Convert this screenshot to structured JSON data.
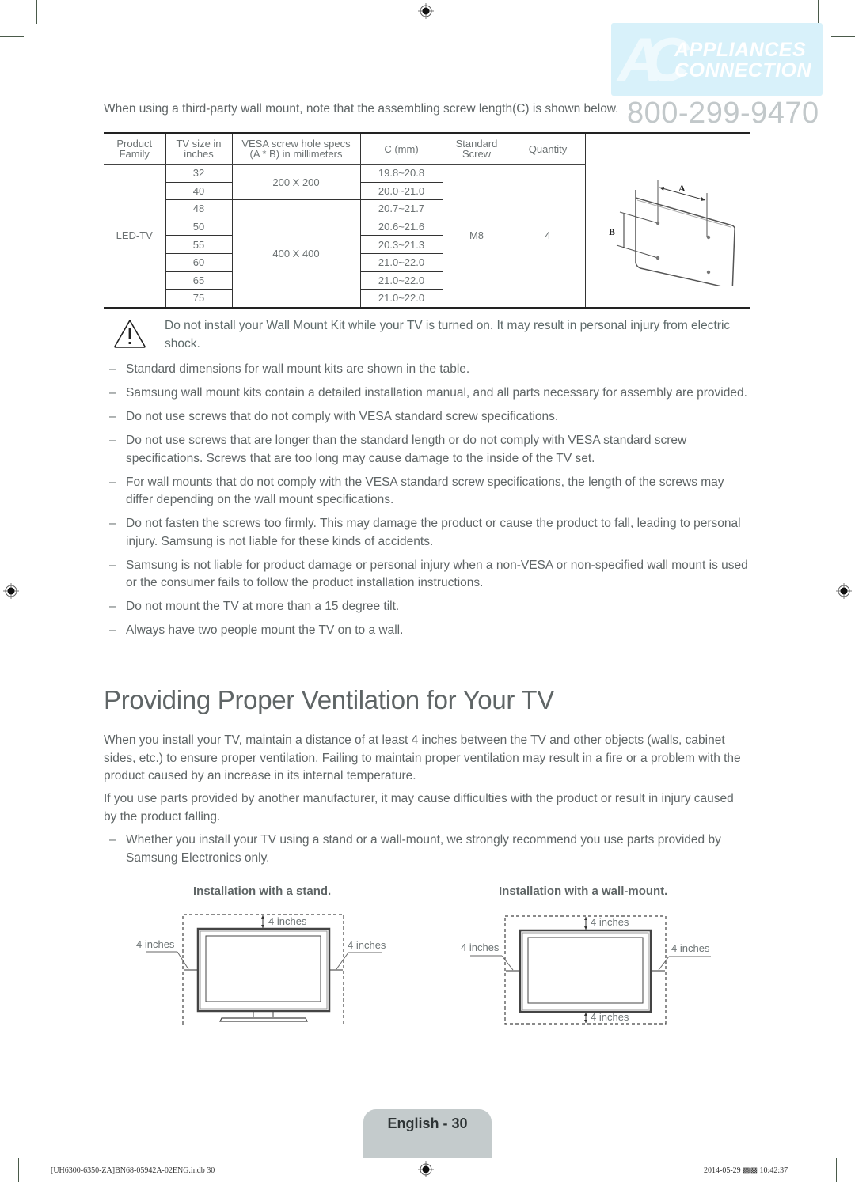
{
  "watermark": {
    "logo_initials": "AC",
    "logo_line1": "APPLIANCES",
    "logo_line2": "CONNECTION",
    "phone": "800-299-9470"
  },
  "intro": "When using a third-party wall mount, note that the assembling screw length(C) is shown below.",
  "table": {
    "headers": {
      "product_family": [
        "Product",
        "Family"
      ],
      "tv_size": [
        "TV size in",
        "inches"
      ],
      "vesa": [
        "VESA screw hole specs",
        "(A * B) in millimeters"
      ],
      "c_mm": "C (mm)",
      "standard_screw": [
        "Standard",
        "Screw"
      ],
      "quantity": "Quantity"
    },
    "product_family": "LED-TV",
    "standard_screw": "M8",
    "quantity": "4",
    "vesa_groups": [
      "200 X 200",
      "400 X 400"
    ],
    "rows": [
      {
        "size": "32",
        "c": "19.8~20.8"
      },
      {
        "size": "40",
        "c": "20.0~21.0"
      },
      {
        "size": "48",
        "c": "20.7~21.7"
      },
      {
        "size": "50",
        "c": "20.6~21.6"
      },
      {
        "size": "55",
        "c": "20.3~21.3"
      },
      {
        "size": "60",
        "c": "21.0~22.0"
      },
      {
        "size": "65",
        "c": "21.0~22.0"
      },
      {
        "size": "75",
        "c": "21.0~22.0"
      }
    ],
    "diagram_labels": {
      "a": "A",
      "b": "B"
    }
  },
  "warning": "Do not install your Wall Mount Kit while your TV is turned on. It may result in personal injury from electric shock.",
  "bullets": [
    "Standard dimensions for wall mount kits are shown in the table.",
    "Samsung wall mount kits contain a detailed installation manual, and all parts necessary for assembly are provided.",
    "Do not use screws that do not comply with VESA standard screw specifications.",
    "Do not use screws that are longer than the standard length or do not comply with VESA standard screw specifications. Screws that are too long may cause damage to the inside of the TV set.",
    "For wall mounts that do not comply with the VESA standard screw specifications, the length of the screws may differ depending on the wall mount specifications.",
    "Do not fasten the screws too firmly. This may damage the product or cause the product to fall, leading to personal injury. Samsung is not liable for these kinds of accidents.",
    "Samsung is not liable for product damage or personal injury when a non-VESA or non-specified wall mount is used or the consumer fails to follow the product installation instructions.",
    "Do not mount the TV at more than a 15 degree tilt.",
    "Always have two people mount the TV on to a wall."
  ],
  "section": {
    "title": "Providing Proper Ventilation for Your TV",
    "para1": "When you install your TV, maintain a distance of at least 4 inches between the TV and other objects (walls, cabinet sides, etc.) to ensure proper ventilation. Failing to maintain proper ventilation may result in a fire or a problem with the product caused by an increase in its internal temperature.",
    "para2": "If you use parts provided by another manufacturer, it may cause difficulties with the product or result in injury caused by the product falling.",
    "bullet": "Whether you install your TV using a stand or a wall-mount, we strongly recommend you use parts provided by Samsung Electronics only."
  },
  "diagrams": {
    "stand": {
      "title": "Installation with a stand.",
      "top": "4 inches",
      "left": "4 inches",
      "right": "4 inches"
    },
    "wall": {
      "title": "Installation with a wall-mount.",
      "top": "4 inches",
      "left": "4 inches",
      "right": "4 inches",
      "bottom": "4 inches"
    }
  },
  "footer": {
    "page_label": "English - 30",
    "file": "[UH6300-6350-ZA]BN68-05942A-02ENG.indb   30",
    "timestamp": "2014-05-29   ▩▩ 10:42:37"
  }
}
